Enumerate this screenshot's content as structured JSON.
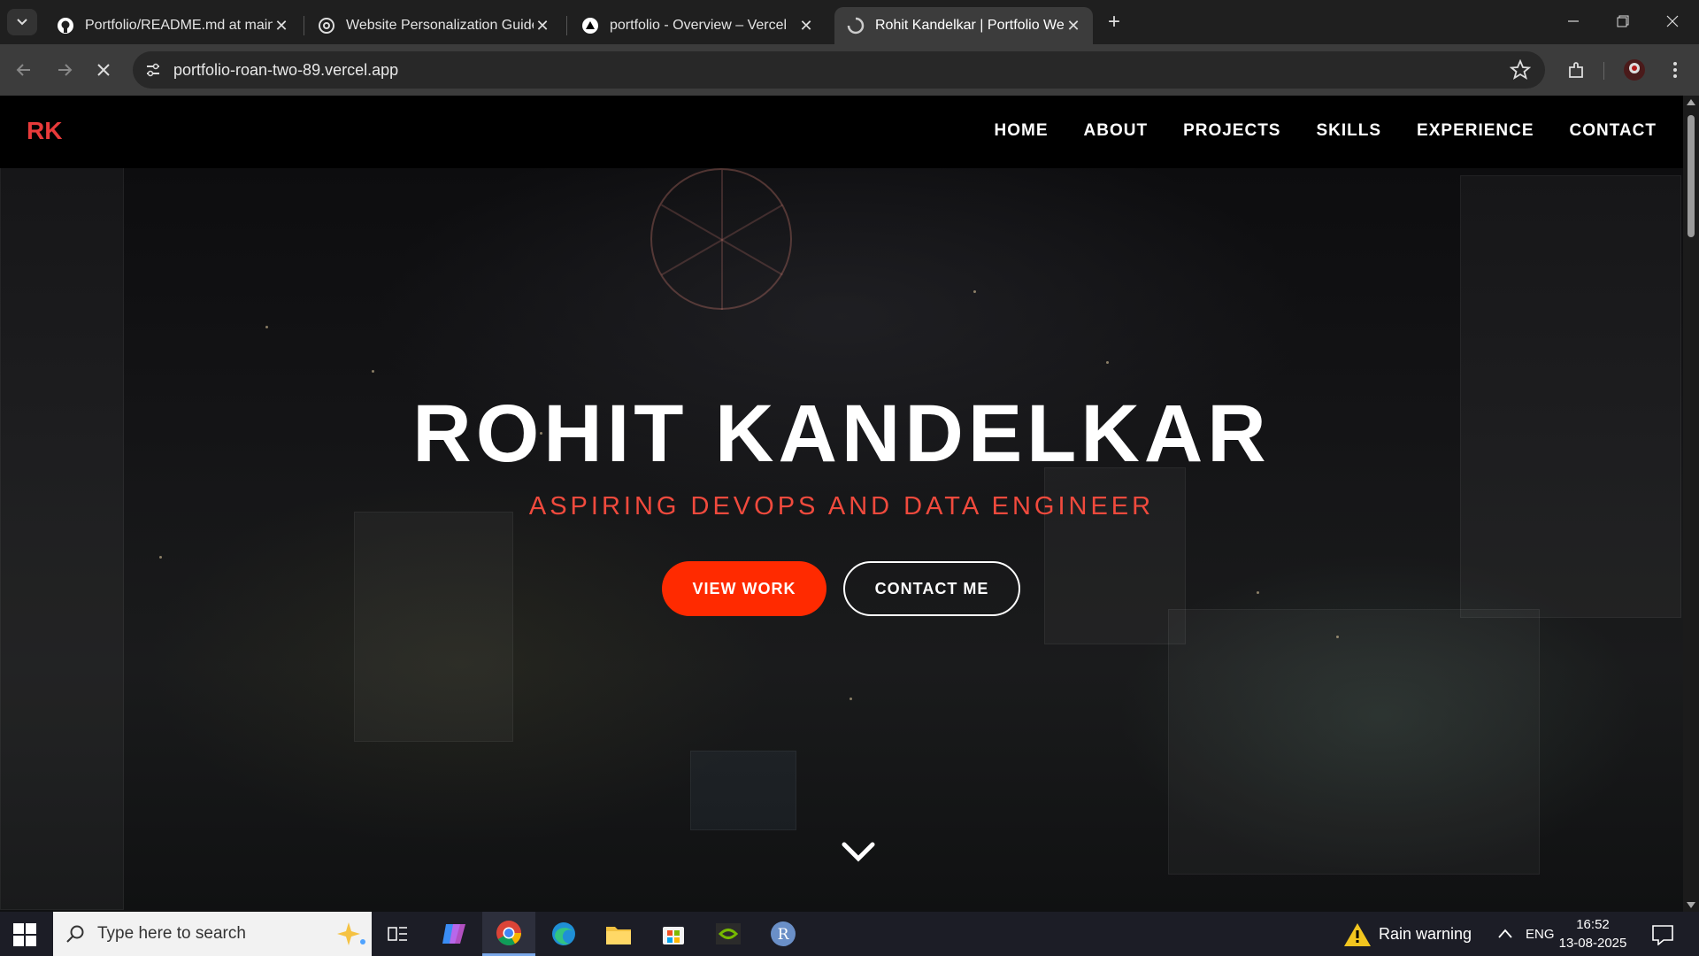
{
  "browser": {
    "tabs": [
      {
        "title": "Portfolio/README.md at main ·",
        "icon": "github-icon"
      },
      {
        "title": "Website Personalization Guide",
        "icon": "chatgpt-icon"
      },
      {
        "title": "portfolio - Overview – Vercel",
        "icon": "vercel-icon"
      },
      {
        "title": "Rohit Kandelkar | Portfolio Web",
        "icon": "loading-icon",
        "active": true
      }
    ],
    "url": "portfolio-roan-two-89.vercel.app"
  },
  "site": {
    "logo": "RK",
    "nav": [
      "HOME",
      "ABOUT",
      "PROJECTS",
      "SKILLS",
      "EXPERIENCE",
      "CONTACT"
    ],
    "hero": {
      "title": "ROHIT KANDELKAR",
      "subtitle": "ASPIRING DEVOPS AND DATA ENGINEER",
      "primary_button": "VIEW WORK",
      "secondary_button": "CONTACT ME"
    },
    "colors": {
      "accent": "#ff2a00",
      "logo": "#e83a3a",
      "subtitle": "#f04a3d"
    }
  },
  "taskbar": {
    "search_placeholder": "Type here to search",
    "weather": "Rain warning",
    "language": "ENG",
    "time": "16:52",
    "date": "13-08-2025"
  }
}
